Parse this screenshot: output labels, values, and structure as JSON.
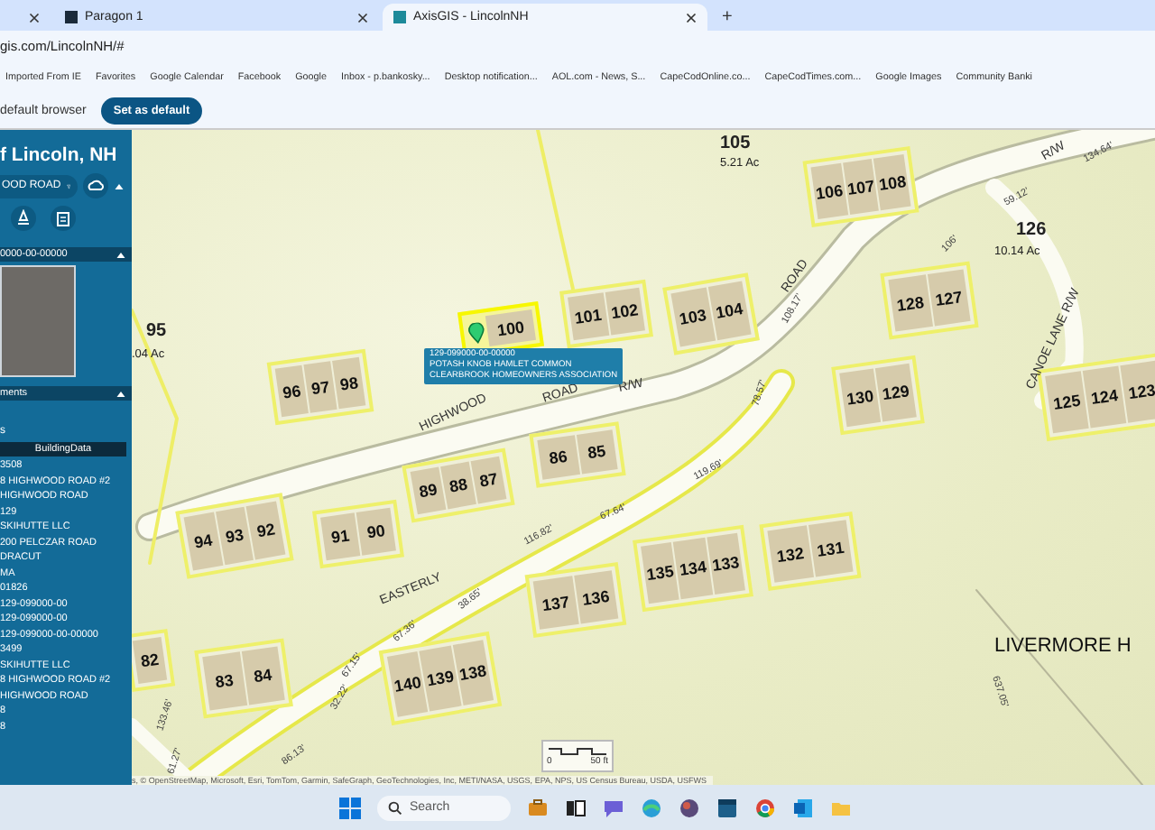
{
  "browser": {
    "tabs": [
      {
        "label": "Paragon 1",
        "selected": false
      },
      {
        "label": "AxisGIS - LincolnNH",
        "selected": true
      }
    ],
    "new_tab": "+",
    "address": "gis.com/LincolnNH/#",
    "bookmarks": [
      "Imported From IE",
      "Favorites",
      "Google Calendar",
      "Facebook",
      "Google",
      "Inbox - p.bankosky...",
      "Desktop notification...",
      "AOL.com - News, S...",
      "CapeCodOnline.co...",
      "CapeCodTimes.com...",
      "Google Images",
      "Community Banki"
    ],
    "default_bar": {
      "text": "default browser",
      "button": "Set as default"
    }
  },
  "sidebar": {
    "title": "f Lincoln, NH",
    "search": {
      "value": "OOD ROAD"
    },
    "parcel_header": "0000-00-00000",
    "comments_header": "ments",
    "comments_text": "s",
    "building_header": "BuildingData",
    "building_rows": [
      "3508",
      "8 HIGHWOOD ROAD #2",
      "HIGHWOOD ROAD",
      "129",
      "SKIHUTTE LLC",
      "200 PELCZAR ROAD",
      "DRACUT",
      "MA",
      "01826",
      "129-099000-00",
      "129-099000-00",
      "129-099000-00-00000",
      "3499",
      "SKIHUTTE LLC",
      "8 HIGHWOOD ROAD #2",
      "HIGHWOOD ROAD",
      "8",
      "8"
    ]
  },
  "map": {
    "parcels": [
      {
        "units": [
          "96",
          "97",
          "98"
        ],
        "selected": false
      },
      {
        "units": [
          "100"
        ],
        "selected": true
      },
      {
        "units": [
          "101",
          "102"
        ],
        "selected": false
      },
      {
        "units": [
          "103",
          "104"
        ],
        "selected": false
      },
      {
        "units": [
          "106",
          "107",
          "108"
        ],
        "selected": false
      },
      {
        "units": [
          "128",
          "127"
        ],
        "selected": false
      },
      {
        "units": [
          "130",
          "129"
        ],
        "selected": false
      },
      {
        "units": [
          "125",
          "124",
          "123"
        ],
        "selected": false
      },
      {
        "units": [
          "86",
          "85"
        ],
        "selected": false
      },
      {
        "units": [
          "89",
          "88",
          "87"
        ],
        "selected": false
      },
      {
        "units": [
          "94",
          "93",
          "92"
        ],
        "selected": false
      },
      {
        "units": [
          "91",
          "90"
        ],
        "selected": false
      },
      {
        "units": [
          "83",
          "84"
        ],
        "selected": false
      },
      {
        "units": [
          "137",
          "136"
        ],
        "selected": false
      },
      {
        "units": [
          "135",
          "134",
          "133"
        ],
        "selected": false
      },
      {
        "units": [
          "132",
          "131"
        ],
        "selected": false
      },
      {
        "units": [
          "140",
          "139",
          "138"
        ],
        "selected": false
      },
      {
        "units": [
          "82"
        ],
        "selected": false
      }
    ],
    "labels": [
      {
        "text": "95",
        "kind": "lot"
      },
      {
        "text": ".04 Ac",
        "kind": "acre"
      },
      {
        "text": "105",
        "kind": "lot"
      },
      {
        "text": "5.21 Ac",
        "kind": "acre"
      },
      {
        "text": "126",
        "kind": "lot"
      },
      {
        "text": "10.14 Ac",
        "kind": "acre"
      },
      {
        "text": "HIGHWOOD",
        "kind": "road"
      },
      {
        "text": "ROAD",
        "kind": "road"
      },
      {
        "text": "R/W",
        "kind": "road"
      },
      {
        "text": "ROAD",
        "kind": "road"
      },
      {
        "text": "R/W",
        "kind": "road"
      },
      {
        "text": "EASTERLY",
        "kind": "road"
      },
      {
        "text": "CANOE LANE R/W",
        "kind": "road"
      },
      {
        "text": "LIVERMORE H",
        "kind": "area"
      },
      {
        "text": "116.82'",
        "kind": "dimension"
      },
      {
        "text": "67.64'",
        "kind": "dimension"
      },
      {
        "text": "119.69'",
        "kind": "dimension"
      },
      {
        "text": "38.65'",
        "kind": "dimension"
      },
      {
        "text": "67.36'",
        "kind": "dimension"
      },
      {
        "text": "67.15'",
        "kind": "dimension"
      },
      {
        "text": "32.22'",
        "kind": "dimension"
      },
      {
        "text": "133.46'",
        "kind": "dimension"
      },
      {
        "text": "61.27'",
        "kind": "dimension"
      },
      {
        "text": "86.13'",
        "kind": "dimension"
      },
      {
        "text": "108.17'",
        "kind": "dimension"
      },
      {
        "text": "78.57'",
        "kind": "dimension"
      },
      {
        "text": "106'",
        "kind": "dimension"
      },
      {
        "text": "59.12'",
        "kind": "dimension"
      },
      {
        "text": "134.64'",
        "kind": "dimension"
      },
      {
        "text": "637.05'",
        "kind": "dimension"
      }
    ],
    "tooltip": [
      "129-099000-00-00000",
      "POTASH KNOB HAMLET COMMON",
      "CLEARBROOK HOMEOWNERS ASSOCIATION"
    ],
    "scale": {
      "start": "0",
      "end": "50 ft"
    },
    "attribution": "s, © OpenStreetMap, Microsoft, Esri, TomTom, Garmin, SafeGraph, GeoTechnologies, Inc, METI/NASA, USGS, EPA, NPS, US Census Bureau, USDA, USFWS"
  },
  "taskbar": {
    "search": {
      "placeholder": "Search"
    }
  }
}
